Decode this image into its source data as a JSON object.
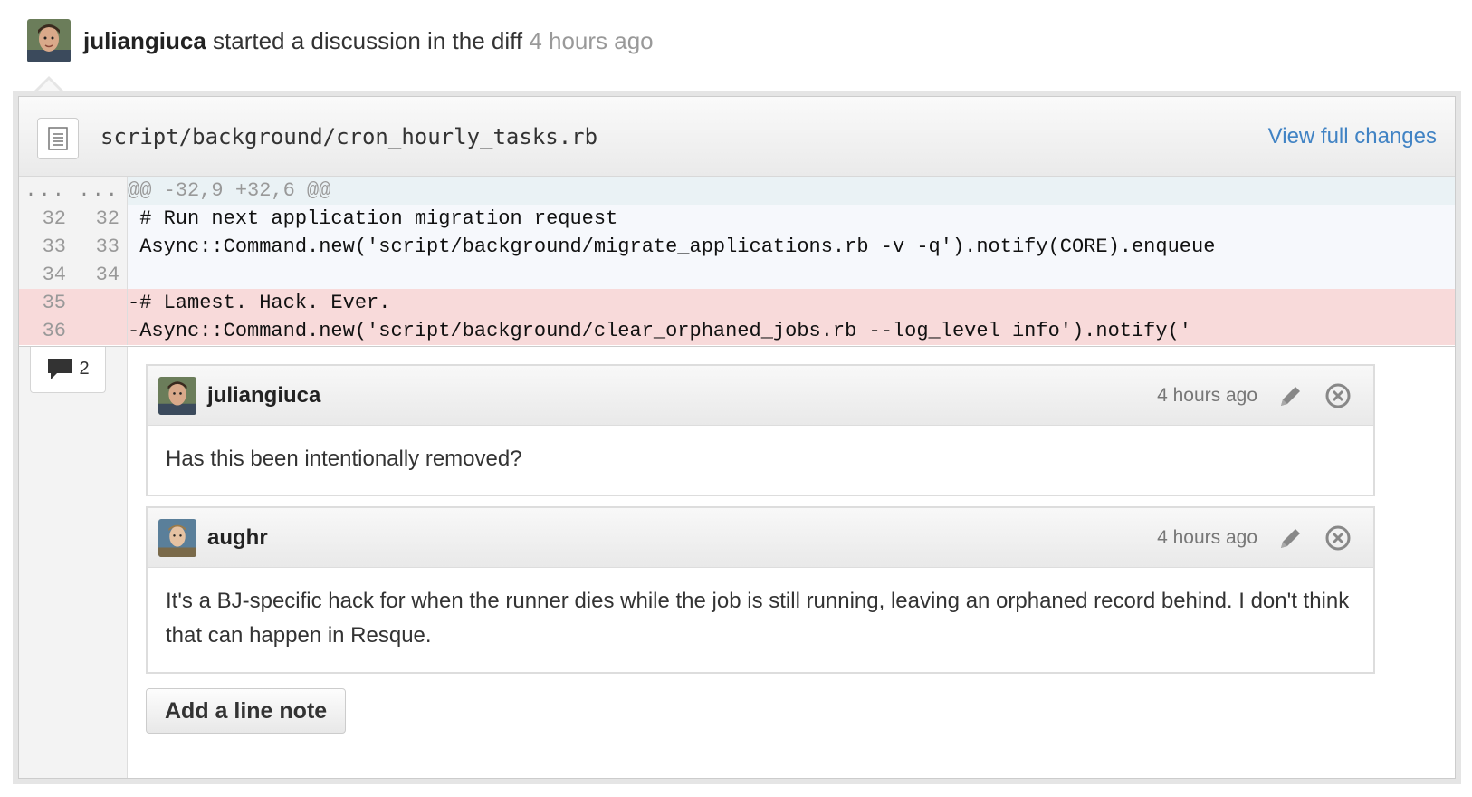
{
  "header": {
    "author": "juliangiuca",
    "action": " started a discussion in the diff ",
    "time": "4 hours ago"
  },
  "file": {
    "name": "script/background/cron_hourly_tasks.rb",
    "view_full_label": "View full changes"
  },
  "diff": {
    "hunk": {
      "old": "...",
      "new": "...",
      "text": "@@ -32,9 +32,6 @@"
    },
    "lines": [
      {
        "old": "32",
        "new": "32",
        "type": "context",
        "text": " # Run next application migration request"
      },
      {
        "old": "33",
        "new": "33",
        "type": "context",
        "text": " Async::Command.new('script/background/migrate_applications.rb -v -q').notify(CORE).enqueue"
      },
      {
        "old": "34",
        "new": "34",
        "type": "context",
        "text": ""
      },
      {
        "old": "35",
        "new": "",
        "type": "deletion",
        "text": "-# Lamest. Hack. Ever."
      },
      {
        "old": "36",
        "new": "",
        "type": "deletion",
        "text": "-Async::Command.new('script/background/clear_orphaned_jobs.rb --log_level info').notify('"
      }
    ]
  },
  "comment_count": "2",
  "comments": [
    {
      "author": "juliangiuca",
      "time": "4 hours ago",
      "body": "Has this been intentionally removed?"
    },
    {
      "author": "aughr",
      "time": "4 hours ago",
      "body": "It's a BJ-specific hack for when the runner dies while the job is still running, leaving an orphaned record behind. I don't think that can happen in Resque."
    }
  ],
  "add_note_label": "Add a line note",
  "colors": {
    "link": "#4183c4",
    "deletion_bg": "#f8dada",
    "hunk_bg": "#eaf2f5"
  }
}
